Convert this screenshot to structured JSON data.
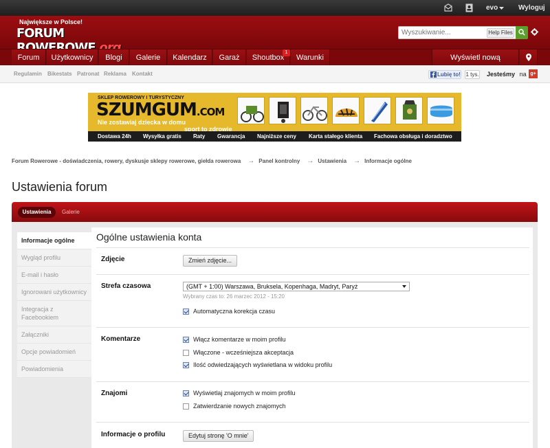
{
  "topbar": {
    "username": "evo",
    "logout": "Wyloguj"
  },
  "header": {
    "logo_top": "Największe w Polsce!",
    "logo_main": "FORUM ROWEROWE",
    "logo_suffix": ".org",
    "search_placeholder": "Wyszukiwanie...",
    "help_files": "Help Files"
  },
  "nav": {
    "items": [
      {
        "label": "Forum"
      },
      {
        "label": "Użytkownicy"
      },
      {
        "label": "Blogi"
      },
      {
        "label": "Galerie"
      },
      {
        "label": "Kalendarz"
      },
      {
        "label": "Garaż"
      },
      {
        "label": "Shoutbox"
      },
      {
        "label": "Warunki"
      }
    ],
    "shoutbox_badge": "1",
    "new_content": "Wyświetl nową zawartość"
  },
  "subnav": {
    "links": [
      {
        "label": "Regulamin"
      },
      {
        "label": "Bikestats"
      },
      {
        "label": "Patronat"
      },
      {
        "label": "Reklama"
      },
      {
        "label": "Kontakt"
      }
    ],
    "like_label": "Lubię to!",
    "like_count": "1 tys.",
    "jestesmy": "Jesteśmy",
    "na": "na",
    "gplus": "g+"
  },
  "banner": {
    "sub": "SKLEP ROWEROWY I TURYSTYCZNY",
    "brand": "SZUMGUM",
    "brand_suffix": ".COM",
    "tagline1": "Nie zostawiaj dziecka w domu",
    "tagline2": "sport to zdrowie",
    "strip": [
      {
        "label": "Dostawa 24h"
      },
      {
        "label": "Wysyłka gratis"
      },
      {
        "label": "Raty"
      },
      {
        "label": "Gwarancja"
      },
      {
        "label": "Najniższe ceny"
      },
      {
        "label": "Karta stałego klienta"
      },
      {
        "label": "Fachowa obsługa i doradztwo"
      }
    ]
  },
  "breadcrumb": {
    "items": [
      {
        "label": "Forum Rowerowe - doświadczenia, rowery, dyskusje sklepy rowerowe, giełda rowerowa"
      },
      {
        "label": "Panel kontrolny"
      },
      {
        "label": "Ustawienia"
      },
      {
        "label": "Informacje ogólne"
      }
    ],
    "separator": "→"
  },
  "page_title": "Ustawienia forum",
  "tabs": {
    "active": "Ustawienia",
    "inactive": "Galerie"
  },
  "sidebar": {
    "items": [
      {
        "label": "Informacje ogólne"
      },
      {
        "label": "Wygląd profilu"
      },
      {
        "label": "E-mail i hasło"
      },
      {
        "label": "Ignorowani użytkownicy"
      },
      {
        "label": "Integracja z Facebookiem"
      },
      {
        "label": "Załączniki"
      },
      {
        "label": "Opcje powiadomień"
      },
      {
        "label": "Powiadomienia"
      }
    ]
  },
  "content": {
    "title": "Ogólne ustawienia konta",
    "zdjecie_label": "Zdjęcie",
    "zdjecie_button": "Zmień zdjęcie...",
    "strefa_label": "Strefa czasowa",
    "strefa_value": "(GMT + 1:00) Warszawa, Bruksela, Kopenhaga, Madryt, Paryż",
    "strefa_hint": "Wybrany czas to: 26 marzec 2012 - 15:20",
    "auto_time": "Automatyczna korekcja czasu",
    "komentarze_label": "Komentarze",
    "kom1": "Włącz komentarze w moim profilu",
    "kom2": "Włączone - wcześniejsza akceptacja",
    "kom3": "Ilość odwiedzających wyświetlana w widoku profilu",
    "znajomi_label": "Znajomi",
    "zn1": "Wyświetlaj znajomych w moim profilu",
    "zn2": "Zatwierdzanie nowych znajomych",
    "profil_label": "Informacje o profilu",
    "profil_button": "Edytuj stronę 'O mnie'"
  }
}
